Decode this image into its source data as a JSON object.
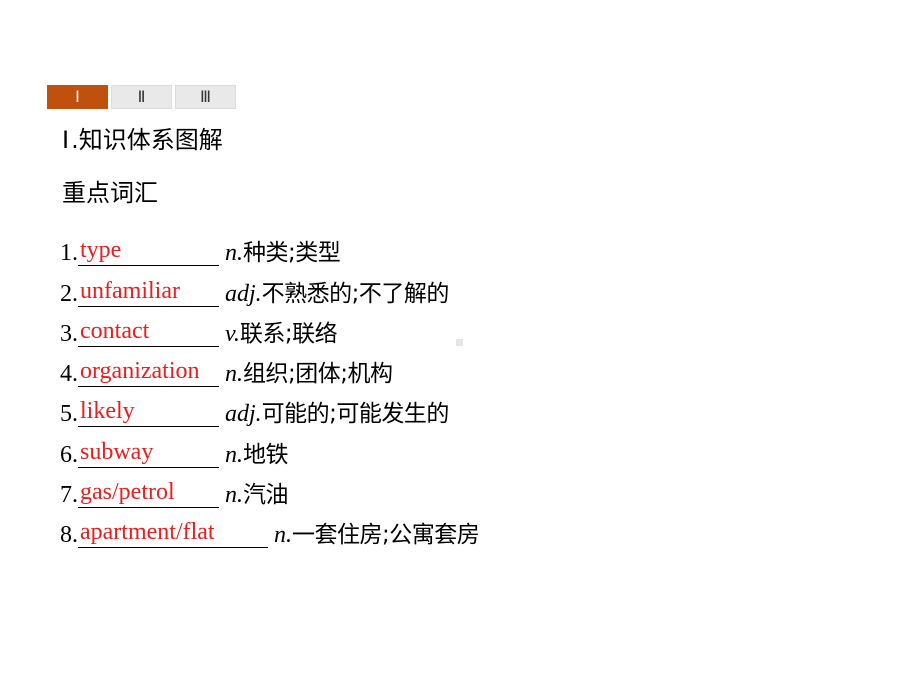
{
  "tabs": [
    {
      "label": "Ⅰ",
      "active": true
    },
    {
      "label": "Ⅱ",
      "active": false
    },
    {
      "label": "Ⅲ",
      "active": false
    }
  ],
  "colors": {
    "active_tab": "#c0500d",
    "inactive_tab": "#e9e9e9",
    "answer_text": "#ee1c1c"
  },
  "section": {
    "roman": "Ⅰ",
    "title": ".知识体系图解"
  },
  "subheading": "重点词汇",
  "vocab": [
    {
      "num": "1.",
      "answer": "type",
      "pos": "n.",
      "meaning": "种类;类型"
    },
    {
      "num": "2.",
      "answer": "unfamiliar",
      "pos": "adj.",
      "meaning": "不熟悉的;不了解的"
    },
    {
      "num": "3.",
      "answer": "contact",
      "pos": "v.",
      "meaning": "联系;联络"
    },
    {
      "num": "4.",
      "answer": "organization",
      "pos": "n.",
      "meaning": "组织;团体;机构"
    },
    {
      "num": "5.",
      "answer": "likely",
      "pos": "adj.",
      "meaning": "可能的;可能发生的"
    },
    {
      "num": "6.",
      "answer": "subway",
      "pos": "n.",
      "meaning": "地铁"
    },
    {
      "num": "7.",
      "answer": "gas/petrol",
      "pos": "n.",
      "meaning": "汽油"
    },
    {
      "num": "8.",
      "answer": "apartment/flat",
      "pos": "n.",
      "meaning": "一套住房;公寓套房"
    }
  ]
}
